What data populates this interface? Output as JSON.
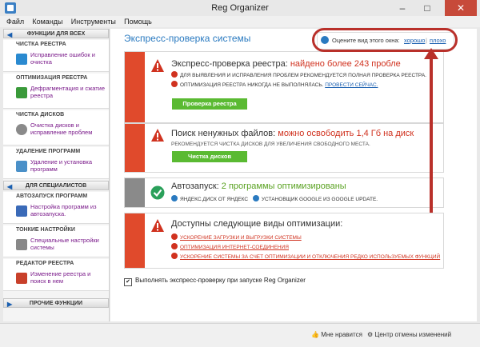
{
  "window": {
    "title": "Reg Organizer",
    "minimize": "–",
    "maximize": "□",
    "close": "✕"
  },
  "menu": [
    "Файл",
    "Команды",
    "Инструменты",
    "Помощь"
  ],
  "sidebar": {
    "sections": [
      {
        "title": "ФУНКЦИИ ДЛЯ ВСЕХ",
        "items": [
          {
            "title": "ЧИСТКА РЕЕСТРА",
            "desc": "Исправление ошибок и очистка",
            "icon": "registry-clean-icon",
            "color": "#2a8ad0"
          },
          {
            "title": "ОПТИМИЗАЦИЯ РЕЕСТРА",
            "desc": "Дефрагментация и сжатие реестра",
            "icon": "registry-optimize-icon",
            "color": "#3a9a3a"
          },
          {
            "title": "ЧИСТКА ДИСКОВ",
            "desc": "Очистка дисков и исправление проблем",
            "icon": "disk-clean-icon",
            "color": "#8a8a8a"
          },
          {
            "title": "УДАЛЕНИЕ ПРОГРАММ",
            "desc": "Удаление и установка программ",
            "icon": "uninstall-icon",
            "color": "#4a90c8"
          }
        ]
      },
      {
        "title": "ДЛЯ СПЕЦИАЛИСТОВ",
        "items": [
          {
            "title": "АВТОЗАПУСК ПРОГРАММ",
            "desc": "Настройка программ из автозапуска.",
            "icon": "autorun-icon",
            "color": "#3a6ab8"
          },
          {
            "title": "ТОНКИЕ НАСТРОЙКИ",
            "desc": "Специальные настройки системы",
            "icon": "tweaks-icon",
            "color": "#888"
          },
          {
            "title": "РЕДАКТОР РЕЕСТРА",
            "desc": "Изменение реестра и поиск в нем",
            "icon": "registry-editor-icon",
            "color": "#c8402a"
          }
        ]
      },
      {
        "title": "ПРОЧИЕ ФУНКЦИИ",
        "items": []
      }
    ]
  },
  "main": {
    "title": "Экспресс-проверка системы",
    "rate": {
      "label": "Оцените вид этого окна:",
      "good": "хорошо",
      "sep": "|",
      "bad": "плохо"
    },
    "card_registry": {
      "title": "Экспресс-проверка реестра:",
      "highlight": "найдено более 243 пробле",
      "line1": "ДЛЯ ВЫЯВЛЕНИЯ И ИСПРАВЛЕНИЯ ПРОБЛЕМ РЕКОМЕНДУЕТСЯ ПОЛНАЯ ПРОВЕРКА РЕЕСТРА.",
      "line2": "ОПТИМИЗАЦИЯ РЕЕСТРА НИКОГДА НЕ ВЫПОЛНЯЛАСЬ.",
      "link": "ПРОВЕСТИ СЕЙЧАС.",
      "button": "Проверка реестра"
    },
    "card_junk": {
      "title": "Поиск ненужных файлов:",
      "highlight": "можно освободить 1,4 Гб на диск",
      "sub": "РЕКОМЕНДУЕТСЯ ЧИСТКА ДИСКОВ ДЛЯ УВЕЛИЧЕНИЯ СВОБОДНОГО МЕСТА.",
      "button": "Чистка дисков"
    },
    "card_autorun": {
      "title": "Автозапуск:",
      "highlight": "2 программы оптимизированы",
      "item1": "ЯНДЕКС.ДИСК ОТ ЯНДЕКС",
      "item2": "УСТАНОВЩИК GOOGLE ИЗ GOOGLE UPDATE."
    },
    "card_optim": {
      "title": "Доступны следующие виды оптимизации:",
      "items": [
        "УСКОРЕНИЕ ЗАГРУЗКИ И ВЫГРУЗКИ СИСТЕМЫ",
        "ОПТИМИЗАЦИЯ ИНТЕРНЕТ-СОЕДИНЕНИЯ",
        "УСКОРЕНИЕ СИСТЕМЫ ЗА СЧЕТ ОПТИМИЗАЦИИ И ОТКЛЮЧЕНИЯ РЕДКО ИСПОЛЬЗУЕМЫХ ФУНКЦИЙ"
      ]
    },
    "checkbox": {
      "label": "Выполнять экспресс-проверку при запуске Reg Organizer",
      "checked": true
    }
  },
  "statusbar": {
    "like": "Мне нравится",
    "changes": "Центр отмены изменений"
  }
}
